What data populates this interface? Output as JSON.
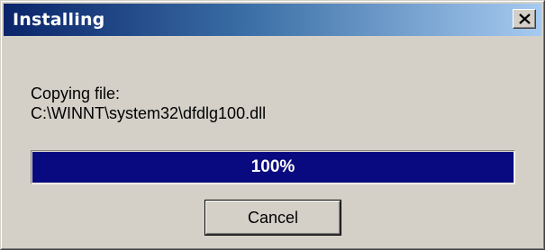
{
  "window": {
    "title": "Installing"
  },
  "titlebar": {
    "close_icon": "close-icon"
  },
  "content": {
    "status_label": "Copying file:",
    "file_path": "C:\\WINNT\\system32\\dfdlg100.dll"
  },
  "progress": {
    "value_fraction": 1.0,
    "text": "100%",
    "fill_color": "#0a0a80"
  },
  "buttons": {
    "cancel_label": "Cancel"
  },
  "colors": {
    "dialog_bg": "#d4d0c8",
    "title_gradient_start": "#0a246a",
    "title_gradient_end": "#a6caf0"
  }
}
